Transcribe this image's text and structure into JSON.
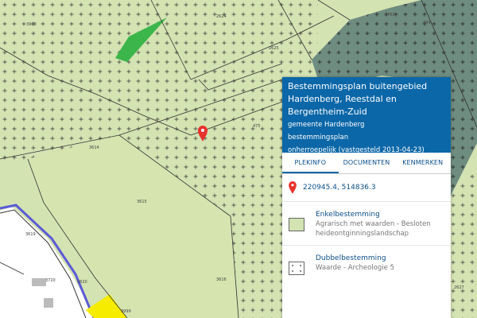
{
  "map": {
    "parcel_labels": [
      "3960",
      "2624",
      "2625",
      "2763",
      "484",
      "475",
      "3614",
      "3615",
      "3616",
      "3619",
      "3720",
      "3820",
      "3999",
      "2627"
    ],
    "colors": {
      "agrarian": "#d4e3b2",
      "dense_zone": "#6f8c80",
      "nature": "#3cb54a",
      "yellow": "#f5ec00",
      "water": "#5b5bd6",
      "lines": "#333333"
    },
    "marker": "map-pin-icon"
  },
  "panel": {
    "title": "Bestemmingsplan buitengebied Hardenberg, Reestdal en Bergentheim-Zuid",
    "municipality": "gemeente Hardenberg",
    "plan_type": "bestemmingsplan",
    "status": "onherroepelijk (vastgesteld 2013-04-23)",
    "tabs": [
      "PLEKINFO",
      "DOCUMENTEN",
      "KENMERKEN"
    ],
    "active_tab": "PLEKINFO",
    "coordinates": "220945.4, 514836.3",
    "items": [
      {
        "title": "Enkelbestemming",
        "description": "Agrarisch met waarden - Besloten heideontginningslandschap",
        "swatch_color": "#d4e3b2",
        "swatch_icon": "none"
      },
      {
        "title": "Dubbelbestemming",
        "description": "Waarde - Archeologie 5",
        "swatch_color": "#ffffff",
        "swatch_icon": "dots-icon"
      }
    ]
  }
}
